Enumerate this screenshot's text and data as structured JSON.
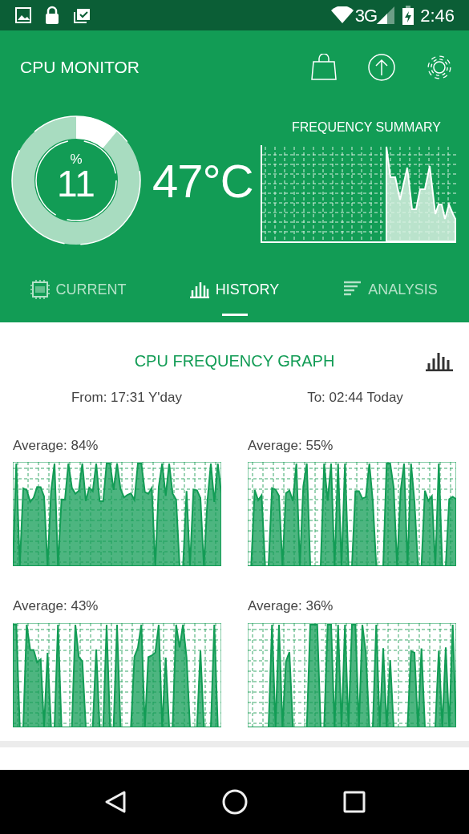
{
  "status_bar": {
    "time": "2:46",
    "network": "3G"
  },
  "app_bar": {
    "title": "CPU MONITOR"
  },
  "gauge": {
    "unit": "%",
    "value": "11",
    "level": 0.11
  },
  "temperature": "47°C",
  "frequency_summary": {
    "title": "FREQUENCY SUMMARY"
  },
  "tabs": [
    {
      "label": "CURRENT",
      "selected": false
    },
    {
      "label": "HISTORY",
      "selected": true
    },
    {
      "label": "ANALYSIS",
      "selected": false
    }
  ],
  "graph_card": {
    "title": "CPU FREQUENCY GRAPH",
    "from": "From: 17:31 Y'day",
    "to": "To: 02:44 Today",
    "cores": [
      {
        "average": "Average: 84%"
      },
      {
        "average": "Average: 55%"
      },
      {
        "average": "Average: 43%"
      },
      {
        "average": "Average: 36%"
      }
    ]
  }
}
